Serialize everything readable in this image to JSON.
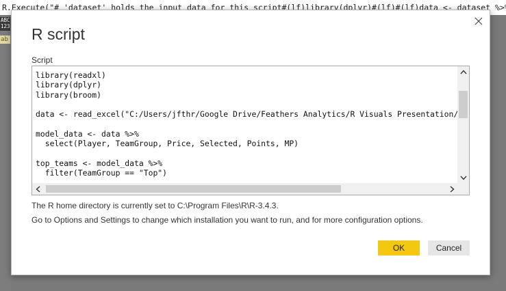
{
  "background": {
    "formula_text": "R.Execute(\"# 'dataset' holds the input data for this script#(lf)library(dplyr)#(lf)#(lf)data <- dataset %>%#(lf)",
    "type_icon_text": "ABC\n123",
    "column_chip_text": "ab"
  },
  "dialog": {
    "title": "R script",
    "close_icon": "close-icon",
    "script_label": "Script",
    "code": "library(readxl)\nlibrary(dplyr)\nlibrary(broom)\n\ndata <- read_excel(\"C:/Users/jfthr/Google Drive/Feathers Analytics/R Visuals Presentation/R Visu\n\nmodel_data <- data %>%\n  select(Player, TeamGroup, Price, Selected, Points, MP)\n\ntop_teams <- model_data %>%\n  filter(TeamGroup == \"Top\")",
    "home_dir_text": "The R home directory is currently set to C:\\Program Files\\R\\R-3.4.3.",
    "options_text": "Go to Options and Settings to change which installation you want to run, and for more configuration options.",
    "ok_label": "OK",
    "cancel_label": "Cancel"
  },
  "colors": {
    "ok_button": "#f2c811",
    "cancel_button": "#e6e6e6",
    "backdrop": "#7a7a7a"
  }
}
